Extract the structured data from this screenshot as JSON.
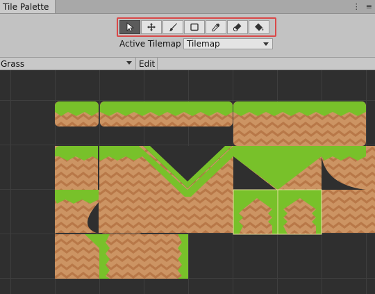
{
  "window": {
    "tab_title": "Tile Palette",
    "menu_icons": [
      "more-vert-icon",
      "window-menu-icon"
    ]
  },
  "toolbar": {
    "tools": [
      {
        "name": "select-tool",
        "icon": "arrow-cursor-icon",
        "active": true
      },
      {
        "name": "move-tool",
        "icon": "move-icon",
        "active": false
      },
      {
        "name": "paint-brush-tool",
        "icon": "paint-brush-icon",
        "active": false
      },
      {
        "name": "box-fill-tool",
        "icon": "rectangle-icon",
        "active": false
      },
      {
        "name": "picker-tool",
        "icon": "eyedropper-icon",
        "active": false
      },
      {
        "name": "erase-tool",
        "icon": "eraser-icon",
        "active": false
      },
      {
        "name": "flood-fill-tool",
        "icon": "paint-bucket-icon",
        "active": false
      }
    ],
    "highlight_color": "#d94848"
  },
  "active_tilemap": {
    "label": "Active Tilemap",
    "value": "Tilemap"
  },
  "palette": {
    "selected": "Grass",
    "edit_label": "Edit"
  },
  "colors": {
    "grid_bg": "#2f2f2f",
    "grass": "#78c12a",
    "grass_dark": "#5da21c",
    "dirt": "#cc9463",
    "dirt_zig": "#b87848",
    "selection_outline": "#e8e0a0"
  }
}
